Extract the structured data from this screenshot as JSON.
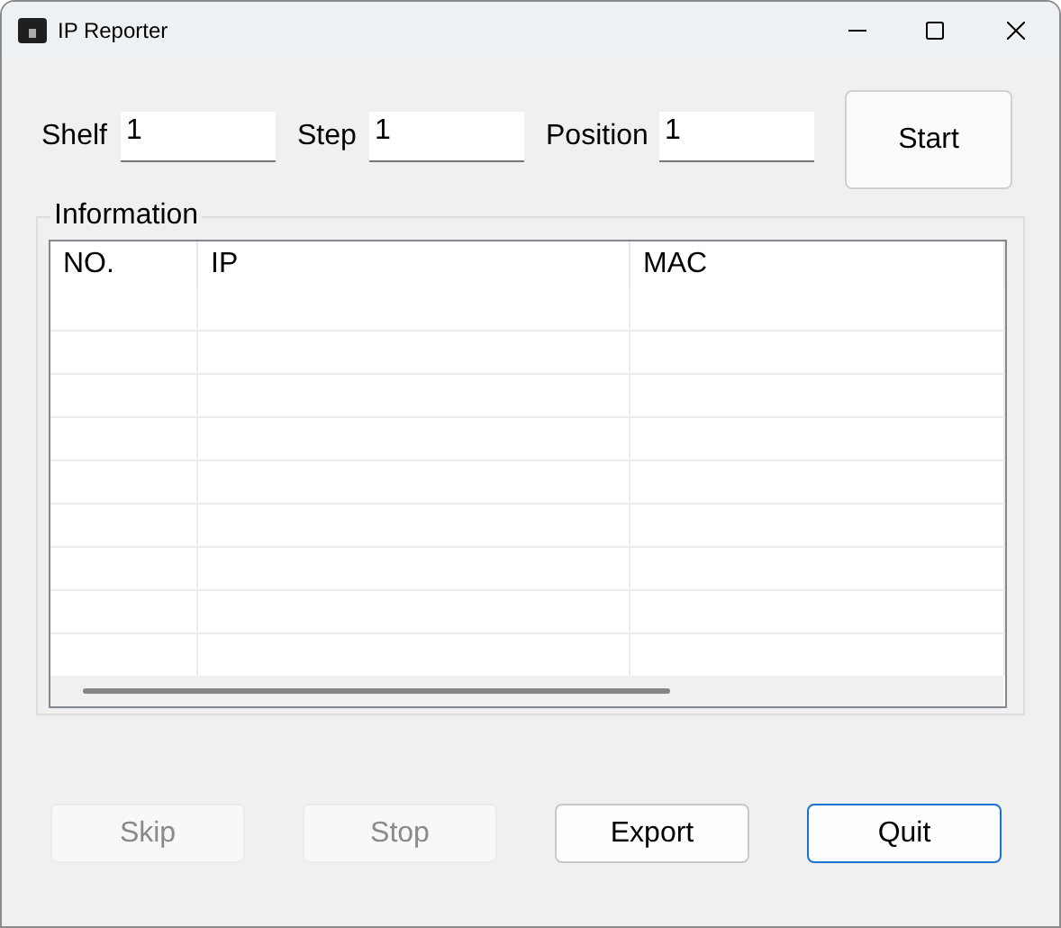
{
  "window": {
    "title": "IP Reporter"
  },
  "fields": [
    {
      "label": "Shelf",
      "value": "1"
    },
    {
      "label": "Step",
      "value": "1"
    },
    {
      "label": "Position",
      "value": "1"
    }
  ],
  "start_button": "Start",
  "group": {
    "title": "Information",
    "columns": [
      "NO.",
      "IP",
      "MAC"
    ]
  },
  "buttons": [
    {
      "label": "Skip",
      "disabled": true,
      "default": false
    },
    {
      "label": "Stop",
      "disabled": true,
      "default": false
    },
    {
      "label": "Export",
      "disabled": false,
      "default": false
    },
    {
      "label": "Quit",
      "disabled": false,
      "default": true
    }
  ]
}
